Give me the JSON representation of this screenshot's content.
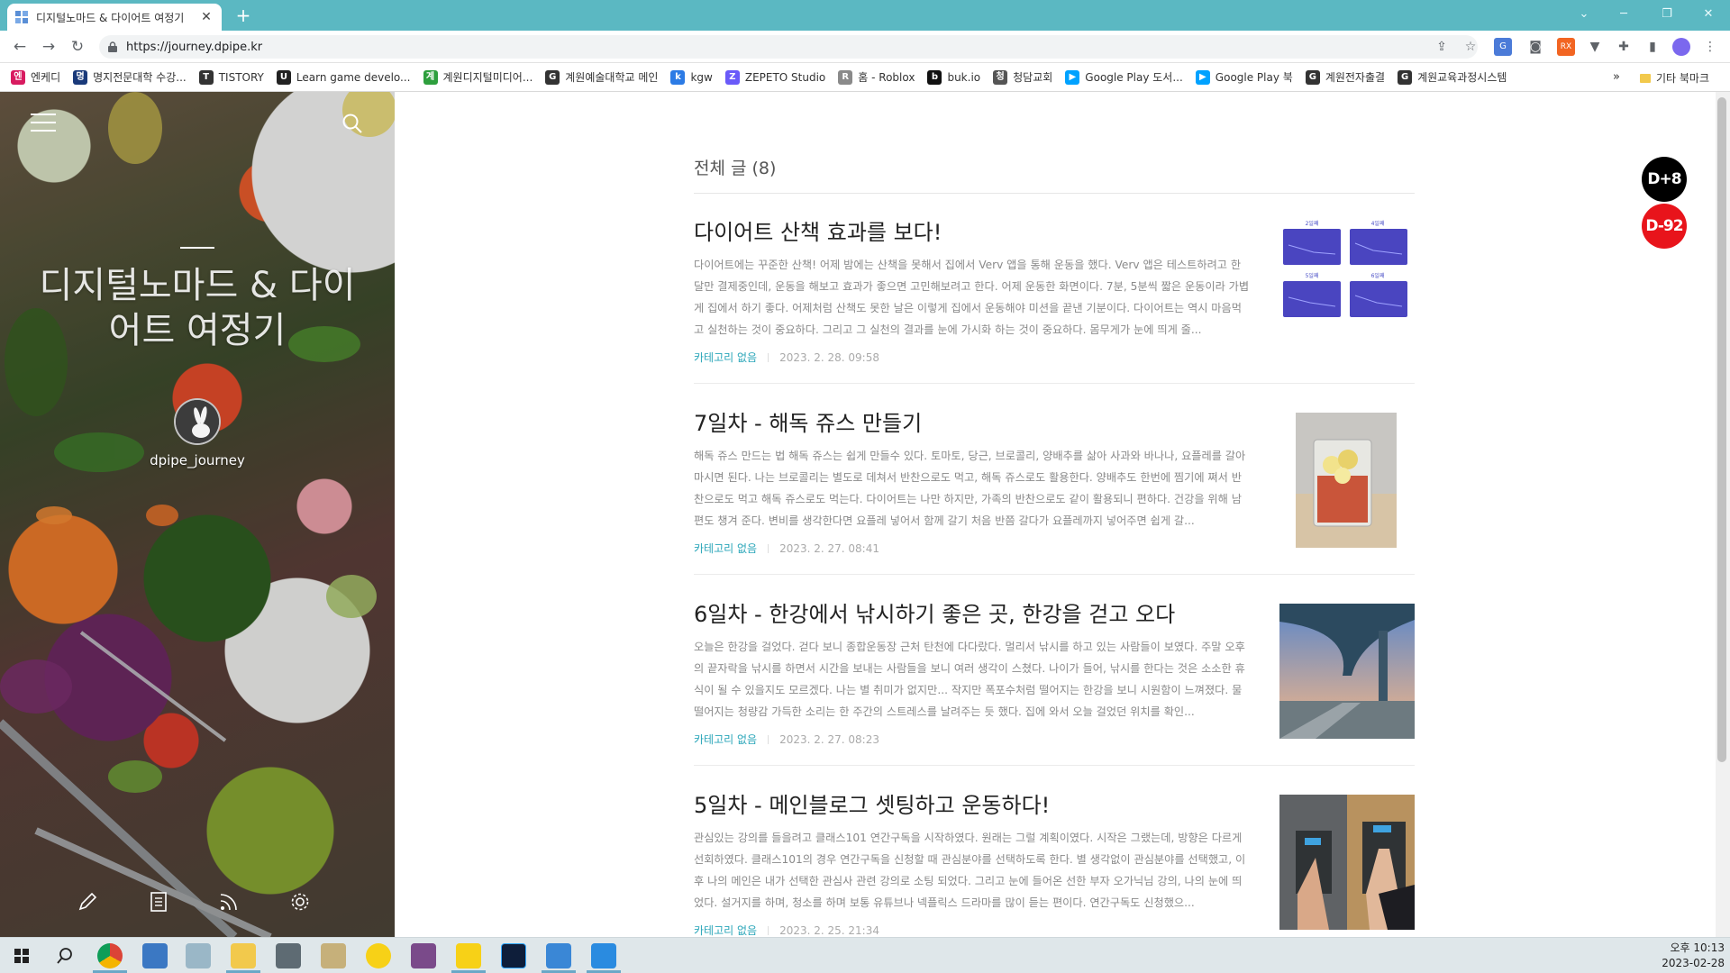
{
  "browser": {
    "tab_title": "디지털노마드 & 다이어트 여정기",
    "url": "https://journey.dpipe.kr"
  },
  "bookmarks": [
    {
      "label": "엔케디",
      "color": "#d81b60",
      "glyph": "엔"
    },
    {
      "label": "명지전문대학 수강...",
      "color": "#1a3a7a",
      "glyph": "명"
    },
    {
      "label": "TISTORY",
      "color": "#333333",
      "glyph": "T"
    },
    {
      "label": "Learn game develo...",
      "color": "#222222",
      "glyph": "U"
    },
    {
      "label": "계원디지털미디어...",
      "color": "#2e9f3e",
      "glyph": "계"
    },
    {
      "label": "계원예술대학교 메인",
      "color": "#333333",
      "glyph": "G"
    },
    {
      "label": "kgw",
      "color": "#2c7be5",
      "glyph": "k"
    },
    {
      "label": "ZEPETO Studio",
      "color": "#6a5af9",
      "glyph": "Z"
    },
    {
      "label": "홈 - Roblox",
      "color": "#8a8a8a",
      "glyph": "R"
    },
    {
      "label": "buk.io",
      "color": "#111111",
      "glyph": "b"
    },
    {
      "label": "청담교회",
      "color": "#555555",
      "glyph": "청"
    },
    {
      "label": "Google Play 도서...",
      "color": "#00a2ff",
      "glyph": "▶"
    },
    {
      "label": "Google Play 북",
      "color": "#00a2ff",
      "glyph": "▶"
    },
    {
      "label": "계원전자출결",
      "color": "#333333",
      "glyph": "G"
    },
    {
      "label": "계원교육과정시스템",
      "color": "#333333",
      "glyph": "G"
    }
  ],
  "bookmarks_overflow": "»",
  "bookmarks_other": "기타 북마크",
  "blog": {
    "title": "디지털노마드 & 다이어트 여정기",
    "blog_id": "dpipe_journey",
    "list_header": "전체 글 (8)"
  },
  "posts": [
    {
      "title": "다이어트 산책 효과를 보다!",
      "excerpt": "다이어트에는 꾸준한 산책! 어제 밤에는 산책을 못해서 집에서 Verv 앱을 통해 운동을 했다. Verv 앱은 테스트하려고 한달만 결제중인데, 운동을 해보고 효과가 좋으면 고민해보려고 한다. 어제 운동한 화면이다. 7분, 5분씩 짧은 운동이라 가볍게 집에서 하기 좋다. 어제처럼 산책도 못한 날은 이렇게 집에서 운동해야 미션을 끝낸 기분이다. 다이어트는 역시 마음먹고 실천하는 것이 중요하다. 그리고 그 실천의 결과를 눈에 가시화 하는 것이 중요하다. 몸무게가 눈에 띄게 줄...",
      "category": "카테고리 없음",
      "date": "2023. 2. 28. 09:58",
      "thumb_labels": [
        "2일째",
        "4일째",
        "5일째",
        "6일째"
      ]
    },
    {
      "title": "7일차 - 해독 쥬스 만들기",
      "excerpt": "해독 쥬스 만드는 법 해독 쥬스는 쉽게 만들수 있다. 토마토, 당근, 브로콜리, 양배추를 삶아 사과와 바나나, 요플레를 갈아 마시면 된다. 나는 브로콜리는 별도로 데쳐서 반찬으로도 먹고, 해독 쥬스로도 활용한다. 양배추도 한번에 찜기에 쪄서 반찬으로도 먹고 해독 쥬스로도 먹는다. 다이어트는 나만 하지만, 가족의 반찬으로도 같이 활용되니 편하다. 건강을 위해 남편도 챙겨 준다. 변비를 생각한다면 요플레 넣어서 함께 갈기 처음 반쯤 갈다가 요플레까지 넣어주면 쉽게 갈...",
      "category": "카테고리 없음",
      "date": "2023. 2. 27. 08:41"
    },
    {
      "title": "6일차 - 한강에서 낚시하기 좋은 곳, 한강을 걷고 오다",
      "excerpt": "오늘은 한강을 걸었다. 걷다 보니 종합운동장 근처 탄천에 다다랐다. 멀리서 낚시를 하고 있는 사람들이 보였다. 주말 오후의 끝자락을 낚시를 하면서 시간을 보내는 사람들을 보니 여러 생각이 스쳤다. 나이가 들어, 낚시를 한다는 것은 소소한 휴식이 될 수 있을지도 모르겠다. 나는 별 취미가 없지만... 작지만 폭포수처럼 떨어지는 한강을 보니 시원함이 느껴졌다. 물떨어지는 청량감 가득한 소리는 한 주간의 스트레스를 날려주는 듯 했다. 집에 와서 오늘 걸었던 위치를 확인...",
      "category": "카테고리 없음",
      "date": "2023. 2. 27. 08:23"
    },
    {
      "title": "5일차 - 메인블로그 셋팅하고 운동하다!",
      "excerpt": "관심있는 강의를 들을려고 클래스101 연간구독을 시작하였다. 원래는 그럴 계획이였다. 시작은 그랬는데, 방향은 다르게 선회하였다. 클래스101의 경우 연간구독을 신청할 때 관심분야를 선택하도록 한다. 별 생각없이 관심분야를 선택했고, 이후 나의 메인은 내가 선택한 관심사 관련 강의로 소팅 되었다. 그리고 눈에 들어온 선한 부자 오가닉님 강의, 나의 눈에 띄었다. 설거지를 하며, 청소를 하며 보통 유튜브나 넥플릭스 드라마를 많이 듣는 편이다. 연간구독도 신청했으...",
      "category": "카테고리 없음",
      "date": "2023. 2. 25. 21:34"
    }
  ],
  "dday": [
    {
      "label": "D+8",
      "color": "#000000"
    },
    {
      "label": "D-92",
      "color": "#e8141b"
    }
  ],
  "clock": {
    "time": "오후 10:13",
    "date": "2023-02-28"
  },
  "colors": {
    "accent": "#2aa6b9",
    "tabbar": "#5bb8c2"
  }
}
